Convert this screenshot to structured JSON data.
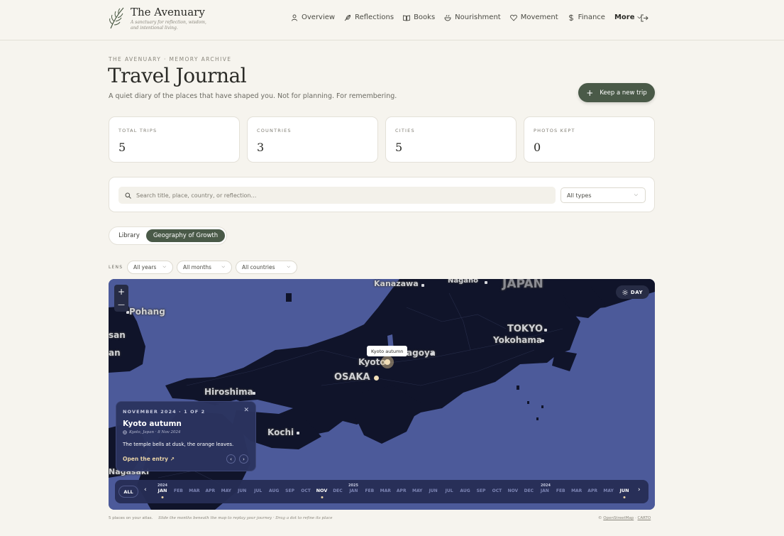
{
  "brand": {
    "title": "The Avenuary",
    "tagline": "A sanctuary for reflection, wisdom, and intentional living."
  },
  "nav": {
    "items": [
      {
        "label": "Overview",
        "icon": "user-icon"
      },
      {
        "label": "Reflections",
        "icon": "feather-icon"
      },
      {
        "label": "Books",
        "icon": "book-open-icon"
      },
      {
        "label": "Nourishment",
        "icon": "bowl-icon"
      },
      {
        "label": "Movement",
        "icon": "heart-icon"
      },
      {
        "label": "Finance",
        "icon": "dollar-icon"
      }
    ],
    "more_label": "More",
    "logout_icon": "logout-icon"
  },
  "page": {
    "eyebrow": "THE AVENUARY · MEMORY ARCHIVE",
    "title": "Travel Journal",
    "subtitle": "A quiet diary of the places that have shaped you. Not for planning. For remembering.",
    "cta_label": "Keep a new trip"
  },
  "stats": [
    {
      "label": "TOTAL TRIPS",
      "value": "5"
    },
    {
      "label": "COUNTRIES",
      "value": "3"
    },
    {
      "label": "CITIES",
      "value": "5"
    },
    {
      "label": "PHOTOS KEPT",
      "value": "0"
    }
  ],
  "search": {
    "placeholder": "Search title, place, country, or reflection…",
    "type_filter": "All types"
  },
  "view_toggle": {
    "library": "Library",
    "geography": "Geography of Growth",
    "active": "geography"
  },
  "lens": {
    "label": "LENS",
    "years": "All years",
    "months": "All months",
    "countries": "All countries"
  },
  "map": {
    "day_label": "DAY",
    "zoom_in": "+",
    "zoom_out": "—",
    "cities": [
      {
        "name": "Kanazawa"
      },
      {
        "name": "Nagano"
      },
      {
        "name": "JAPAN"
      },
      {
        "name": "Pohang"
      },
      {
        "name": "TOKYO"
      },
      {
        "name": "Yokohama"
      },
      {
        "name": "Nagoya"
      },
      {
        "name": "Kyoto"
      },
      {
        "name": "OSAKA"
      },
      {
        "name": "Hiroshima"
      },
      {
        "name": "Kochi"
      },
      {
        "name": "Nagasaki"
      },
      {
        "name": "san"
      },
      {
        "name": "an"
      }
    ],
    "tooltip": "Kyoto autumn",
    "entry": {
      "eyebrow": "NOVEMBER 2024 · 1 OF 2",
      "title": "Kyoto autumn",
      "meta": "Kyoto, Japan · 8 Nov 2024",
      "quote": "The temple bells at dusk, the orange leaves.",
      "link": "Open the entry ↗"
    },
    "timeline": {
      "all_label": "ALL",
      "years": [
        {
          "label": "2024"
        },
        {
          "label": "2025"
        },
        {
          "label": "2024"
        }
      ],
      "months": [
        "JAN",
        "FEB",
        "MAR",
        "APR",
        "MAY",
        "JUN",
        "JUL",
        "AUG",
        "SEP",
        "OCT",
        "NOV",
        "DEC",
        "JAN",
        "FEB",
        "MAR",
        "APR",
        "MAY",
        "JUN",
        "JUL",
        "AUG",
        "SEP",
        "OCT",
        "NOV",
        "DEC",
        "JAN",
        "FEB",
        "MAR",
        "APR",
        "MAY",
        "JUN"
      ]
    }
  },
  "footer": {
    "count": "5 places on your atlas.",
    "hint": "Slide the months beneath the map to replay your journey · Drag a dot to refine its place",
    "attribution_prefix": "©",
    "osm": "OpenStreetMap",
    "carto": "CARTO"
  },
  "colors": {
    "accent": "#4a5a48",
    "map_sea": "#4c5a9a",
    "map_land": "#10142a",
    "panel": "#272c45",
    "pin": "#f2dfb8"
  }
}
